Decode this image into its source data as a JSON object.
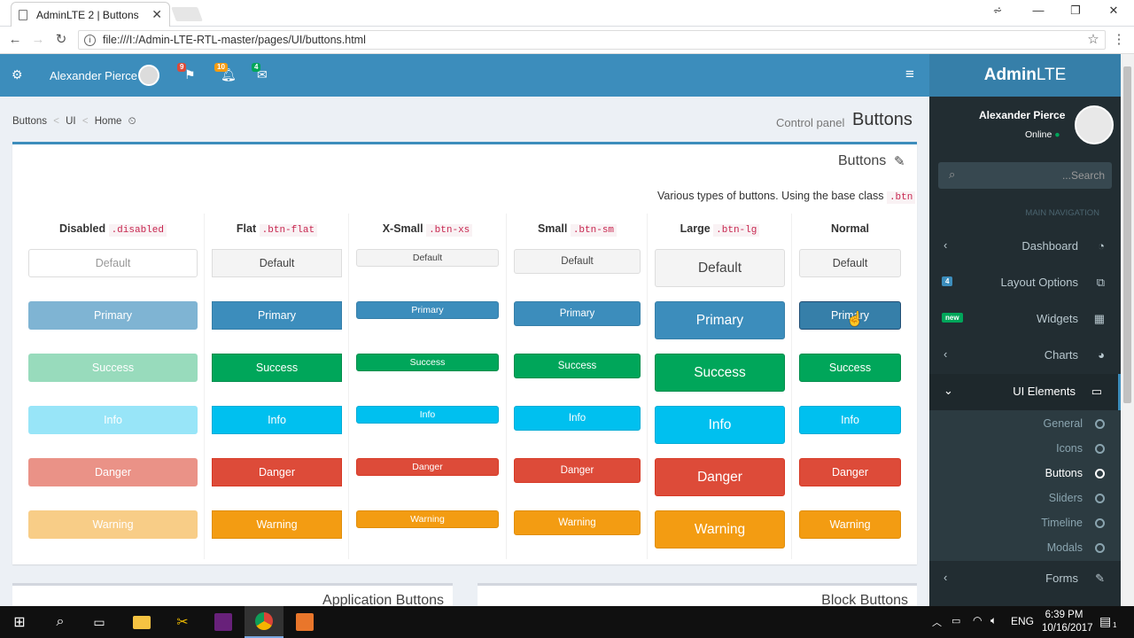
{
  "browser": {
    "tab_title": "AdminLTE 2 | Buttons",
    "url": "file:///I:/Admin-LTE-RTL-master/pages/UI/buttons.html"
  },
  "header": {
    "user_name": "Alexander Pierce",
    "badge_flags": "9",
    "badge_bell": "10",
    "badge_mail": "4",
    "brand_bold": "Admin",
    "brand_light": "LTE"
  },
  "breadcrumb": {
    "items": [
      "Buttons",
      "UI",
      "Home"
    ],
    "sep": "<"
  },
  "page": {
    "title": "Buttons",
    "subtitle": "Control panel"
  },
  "box": {
    "title": "Buttons",
    "description": "Various types of buttons. Using the base class",
    "description_code": ".btn"
  },
  "columns": [
    {
      "label": "Disabled",
      "code": ".disabled"
    },
    {
      "label": "Flat",
      "code": ".btn-flat"
    },
    {
      "label": "X-Small",
      "code": ".btn-xs"
    },
    {
      "label": "Small",
      "code": ".btn-sm"
    },
    {
      "label": "Large",
      "code": ".btn-lg"
    },
    {
      "label": "Normal",
      "code": ""
    }
  ],
  "buttons": [
    "Default",
    "Primary",
    "Success",
    "Info",
    "Danger",
    "Warning"
  ],
  "colors": {
    "primary": "#3c8dbc",
    "success": "#00a65a",
    "info": "#00c0ef",
    "danger": "#dd4b39",
    "warning": "#f39c12",
    "default": "#f4f4f4",
    "sidebar": "#222d32"
  },
  "lower_boxes": [
    "Application Buttons",
    "Block Buttons"
  ],
  "sidebar": {
    "user_name": "Alexander Pierce",
    "status": "Online",
    "search_placeholder": "...Search",
    "nav_header": "MAIN NAVIGATION",
    "items": [
      {
        "label": "Dashboard",
        "icon": "dashboard-icon"
      },
      {
        "label": "Layout Options",
        "badge": "4",
        "icon": "files-icon"
      },
      {
        "label": "Widgets",
        "badge": "new",
        "icon": "th-icon"
      },
      {
        "label": "Charts",
        "icon": "pie-chart-icon"
      },
      {
        "label": "UI Elements",
        "icon": "laptop-icon"
      },
      {
        "label": "Forms",
        "icon": "edit-icon"
      }
    ],
    "sub_items": [
      "General",
      "Icons",
      "Buttons",
      "Sliders",
      "Timeline",
      "Modals"
    ],
    "active_sub": "Buttons"
  },
  "taskbar": {
    "lang": "ENG",
    "time": "6:39 PM",
    "date": "10/16/2017",
    "notif": "1"
  }
}
